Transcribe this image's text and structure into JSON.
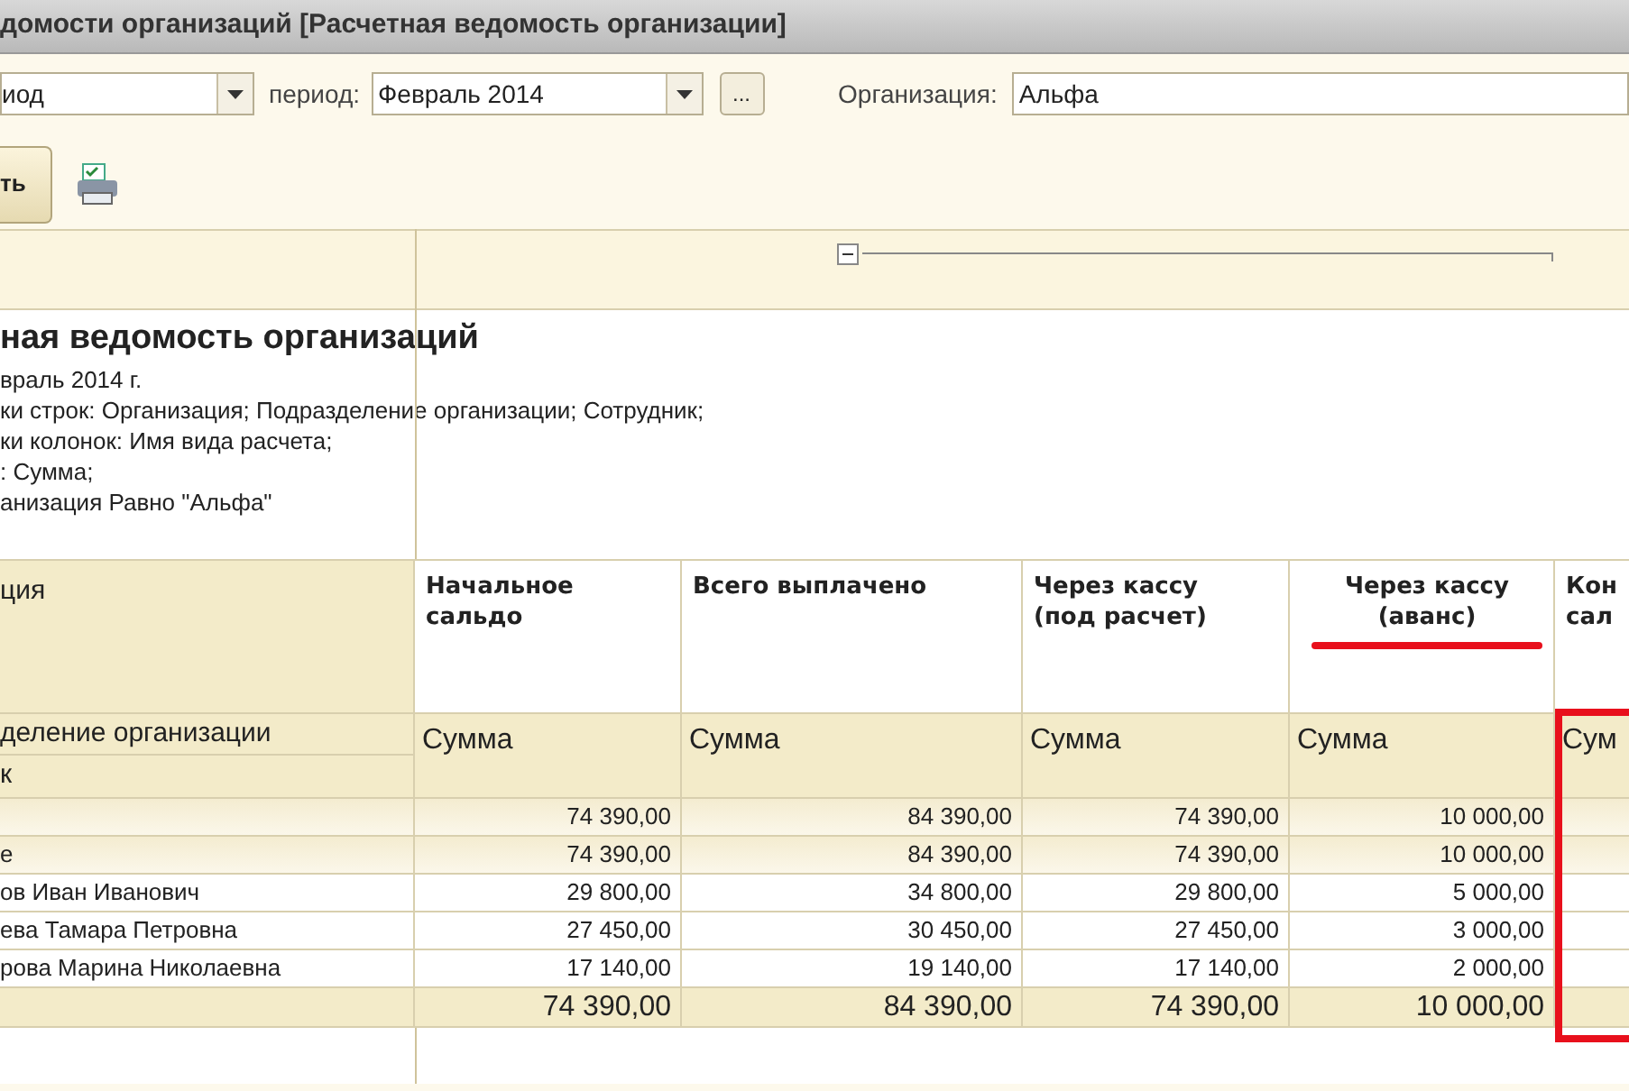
{
  "window": {
    "title": "домости организаций [Расчетная ведомость организации]"
  },
  "filters": {
    "period_kind": {
      "value": "иод"
    },
    "period_label": "период:",
    "period": {
      "value": "Февраль 2014"
    },
    "more_button": "...",
    "organization_label": "Организация:",
    "organization": {
      "value": "Альфа"
    }
  },
  "toolbar": {
    "button": "ть"
  },
  "report": {
    "title": "ная ведомость организаций",
    "details": [
      "враль 2014 г.",
      "ки строк: Организация; Подразделение организации; Сотрудник;",
      "ки колонок: Имя вида расчета;",
      ": Сумма;",
      "анизация Равно \"Альфа\""
    ],
    "columns": [
      {
        "lines": [
          "ция"
        ]
      },
      {
        "lines": [
          "Начальное",
          "сальдо"
        ]
      },
      {
        "lines": [
          "Всего выплачено"
        ]
      },
      {
        "lines": [
          "Через кассу",
          "(под расчет)"
        ]
      },
      {
        "lines": [
          "Через кассу",
          "(аванс)"
        ],
        "underlined": true
      },
      {
        "lines": [
          "Кон",
          "сал"
        ]
      }
    ],
    "subheader": {
      "lines": [
        "деление организации",
        "к"
      ],
      "cells": [
        "Сумма",
        "Сумма",
        "Сумма",
        "Сумма",
        "Сум"
      ]
    },
    "rows": [
      {
        "kind": "group",
        "values": [
          "74 390,00",
          "84 390,00",
          "74 390,00",
          "10 000,00"
        ]
      },
      {
        "kind": "group",
        "label": "е",
        "values": [
          "74 390,00",
          "84 390,00",
          "74 390,00",
          "10 000,00"
        ]
      },
      {
        "kind": "employee",
        "label": "ов Иван Иванович",
        "values": [
          "29 800,00",
          "34 800,00",
          "29 800,00",
          "5 000,00"
        ]
      },
      {
        "kind": "employee",
        "label": "ева Тамара Петровна",
        "values": [
          "27 450,00",
          "30 450,00",
          "27 450,00",
          "3 000,00"
        ]
      },
      {
        "kind": "employee",
        "label": "рова Марина Николаевна",
        "values": [
          "17 140,00",
          "19 140,00",
          "17 140,00",
          "2 000,00"
        ]
      },
      {
        "kind": "total",
        "values": [
          "74 390,00",
          "84 390,00",
          "74 390,00",
          "10 000,00"
        ]
      }
    ],
    "highlighted_column": true
  }
}
